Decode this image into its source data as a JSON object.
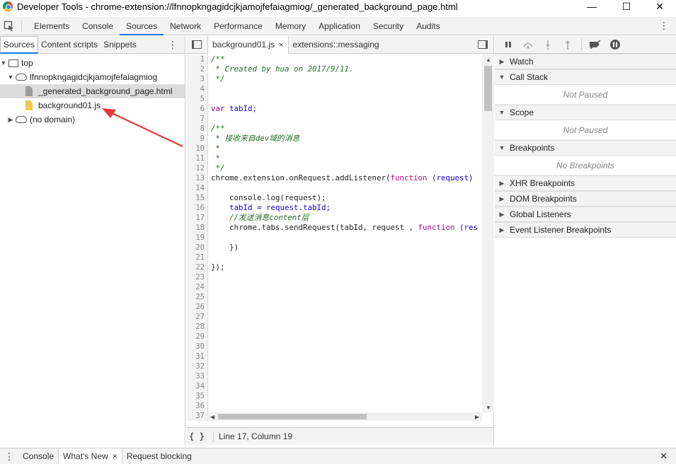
{
  "window": {
    "title": "Developer Tools - chrome-extension://lfnnopkngagidcjkjamojfefaiagmiog/_generated_background_page.html",
    "controls": {
      "minimize": "—",
      "maximize": "☐",
      "close": "✕"
    }
  },
  "main_tabs": [
    "Elements",
    "Console",
    "Sources",
    "Network",
    "Performance",
    "Memory",
    "Application",
    "Security",
    "Audits"
  ],
  "active_main_tab": "Sources",
  "navigator": {
    "tabs": [
      "Sources",
      "Content scripts",
      "Snippets"
    ],
    "tree": [
      {
        "label": "top",
        "icon": "frame-icon",
        "arrow": "▼"
      },
      {
        "label": "lfnnopkngagidcjkjamojfefaiagmiog",
        "icon": "cloud-icon",
        "arrow": "▼"
      },
      {
        "label": "_generated_background_page.html",
        "icon": "file-icon",
        "color": "#9a9a9a"
      },
      {
        "label": "background01.js",
        "icon": "js-file-icon",
        "color": "#f2c94c"
      },
      {
        "label": "(no domain)",
        "icon": "cloud-icon",
        "arrow": "▶"
      }
    ]
  },
  "editor": {
    "tabs": [
      {
        "label": "background01.js",
        "close": "×"
      },
      {
        "label": "extensions::messaging"
      }
    ],
    "line_numbers": [
      "1",
      "2",
      "3",
      "4",
      "5",
      "6",
      "7",
      "8",
      "9",
      "10",
      "11",
      "12",
      "13",
      "14",
      "15",
      "16",
      "17",
      "18",
      "19",
      "20",
      "21",
      "22",
      "23",
      "24",
      "25",
      "26",
      "27",
      "28",
      "29",
      "30",
      "31",
      "32",
      "33",
      "34",
      "35",
      "36",
      "37"
    ],
    "code": {
      "l1": "/**",
      "l2": " * Created by hua on 2017/9/11.",
      "l3": " */",
      "l6_kw": "var",
      "l6_rest": " tabId;",
      "l8": "/**",
      "l9": " * 接收来自dev域的消息",
      "l10": " *",
      "l11": " *",
      "l12": " */",
      "l13_a": "chrome.extension.onRequest.addListener(",
      "l13_kw": "function",
      "l13_b": " (request)",
      "l15": "    console.log(request);",
      "l16": "    tabId = request.tabId;",
      "l17": "    //发送消息content层",
      "l18_a": "    chrome.tabs.sendRequest(tabId, request , ",
      "l18_kw": "function",
      "l18_b": " (res",
      "l20": "    })",
      "l22": "});"
    },
    "status": {
      "pretty_print": "{ }",
      "cursor": "Line 17, Column 19"
    }
  },
  "sidebar": {
    "sections": [
      {
        "label": "Watch",
        "body": ""
      },
      {
        "label": "Call Stack",
        "body": "Not Paused"
      },
      {
        "label": "Scope",
        "body": "Not Paused"
      },
      {
        "label": "Breakpoints",
        "body": "No Breakpoints"
      },
      {
        "label": "XHR Breakpoints",
        "body": ""
      },
      {
        "label": "DOM Breakpoints",
        "body": ""
      },
      {
        "label": "Global Listeners",
        "body": ""
      },
      {
        "label": "Event Listener Breakpoints",
        "body": ""
      }
    ]
  },
  "drawer": {
    "tabs": [
      {
        "label": "Console"
      },
      {
        "label": "What's New",
        "close": "×"
      },
      {
        "label": "Request blocking"
      }
    ],
    "close": "✕"
  },
  "colors": {
    "accent": "#1a73e8",
    "annotation_arrow": "#e53935"
  }
}
